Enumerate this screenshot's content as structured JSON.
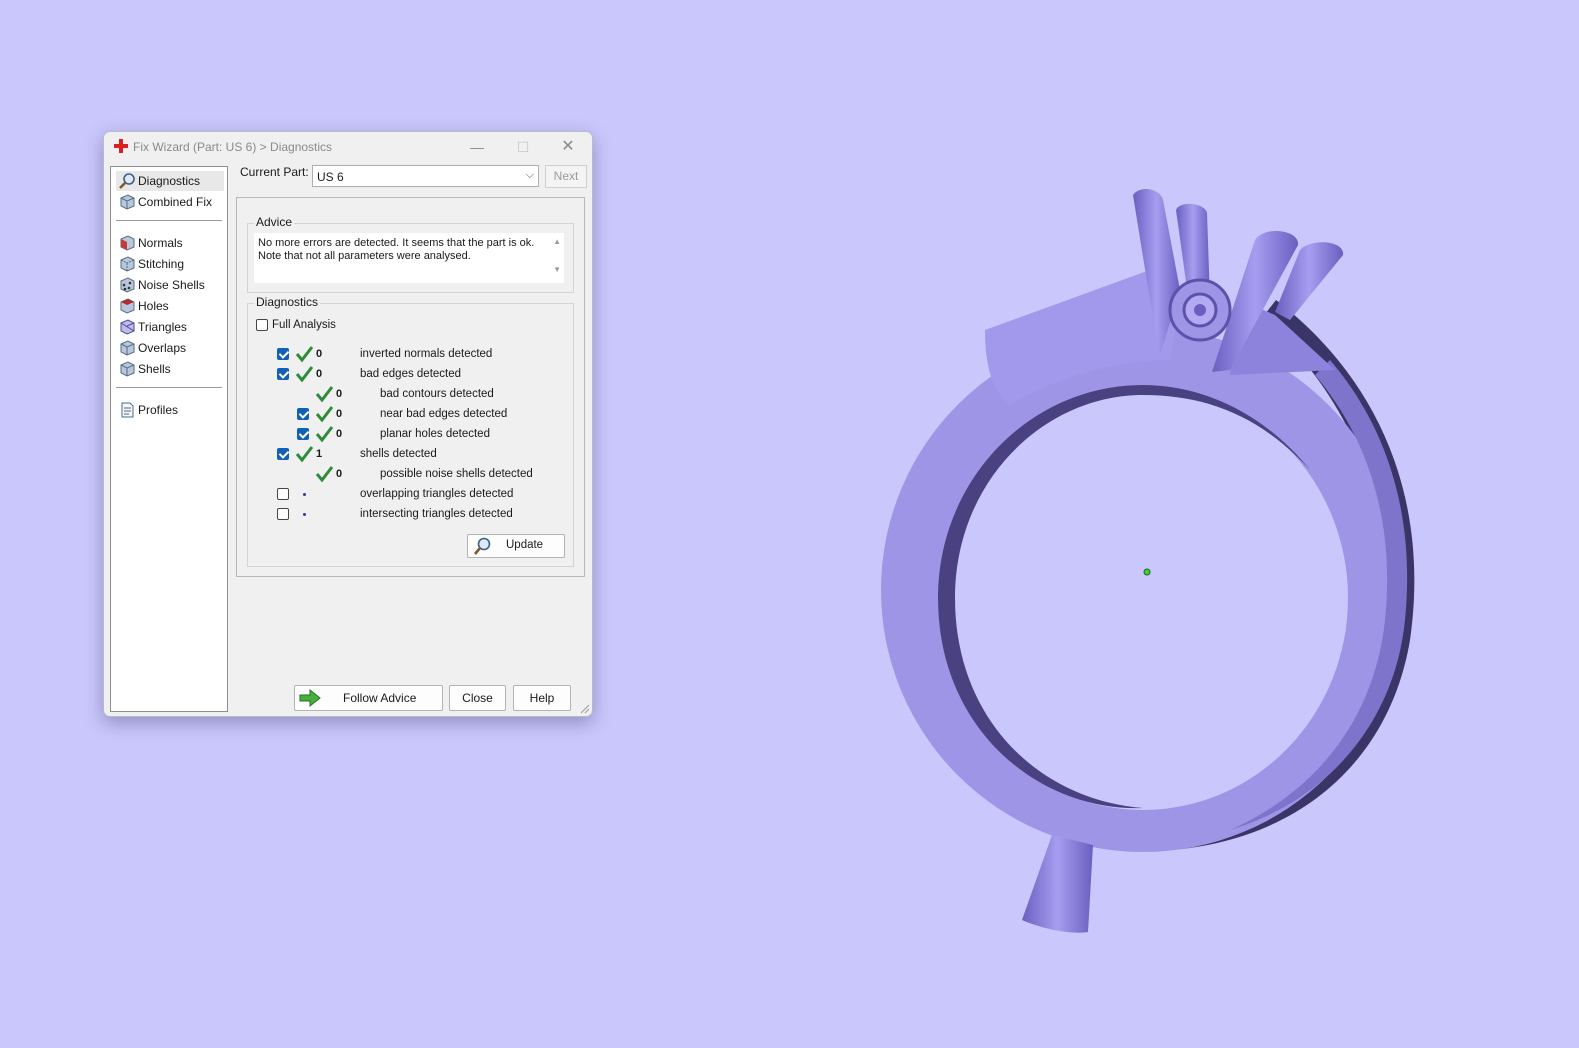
{
  "window": {
    "title": "Fix Wizard (Part: US 6) > Diagnostics",
    "minimize_icon": "minimize-icon",
    "maximize_icon": "maximize-icon",
    "close_icon": "close-icon"
  },
  "nav": {
    "items": [
      {
        "label": "Diagnostics",
        "icon": "magnifier-icon",
        "selected": true
      },
      {
        "label": "Combined Fix",
        "icon": "cube-icon"
      },
      {
        "label": "Normals",
        "icon": "normals-cube-icon"
      },
      {
        "label": "Stitching",
        "icon": "stitching-cube-icon"
      },
      {
        "label": "Noise Shells",
        "icon": "noise-shells-icon"
      },
      {
        "label": "Holes",
        "icon": "holes-cube-icon"
      },
      {
        "label": "Triangles",
        "icon": "triangles-cube-icon"
      },
      {
        "label": "Overlaps",
        "icon": "overlaps-cube-icon"
      },
      {
        "label": "Shells",
        "icon": "shells-cube-icon"
      },
      {
        "label": "Profiles",
        "icon": "document-icon"
      }
    ]
  },
  "current_part": {
    "label": "Current Part:",
    "value": "US 6",
    "next_label": "Next"
  },
  "advice": {
    "title": "Advice",
    "text": "No more errors are detected. It seems that the part is ok. Note that not all parameters were analysed."
  },
  "diagnostics": {
    "title": "Diagnostics",
    "full_analysis_label": "Full Analysis",
    "full_analysis_checked": false,
    "rows": [
      {
        "checked": true,
        "status": "ok",
        "count": "0",
        "label": "inverted normals detected",
        "indent": 0
      },
      {
        "checked": true,
        "status": "ok",
        "count": "0",
        "label": "bad edges detected",
        "indent": 0
      },
      {
        "checkbox": false,
        "status": "ok",
        "count": "0",
        "label": "bad contours detected",
        "indent": 1
      },
      {
        "checked": true,
        "status": "ok",
        "count": "0",
        "label": "near bad edges detected",
        "indent": 1
      },
      {
        "checked": true,
        "status": "ok",
        "count": "0",
        "label": "planar holes detected",
        "indent": 1
      },
      {
        "checked": true,
        "status": "ok",
        "count": "1",
        "label": "shells detected",
        "indent": 0
      },
      {
        "checkbox": false,
        "status": "ok",
        "count": "0",
        "label": "possible noise shells detected",
        "indent": 1
      },
      {
        "checked": false,
        "status": "not-analysed",
        "count": "",
        "label": "overlapping triangles detected",
        "indent": 0
      },
      {
        "checked": false,
        "status": "not-analysed",
        "count": "",
        "label": "intersecting triangles detected",
        "indent": 0
      }
    ],
    "update_label": "Update"
  },
  "buttons": {
    "follow_advice": "Follow Advice",
    "close": "Close",
    "help": "Help"
  },
  "colors": {
    "background": "#c9c7fb",
    "model": "#9f95e6",
    "checkbox_on": "#1160b8",
    "tick": "#2e8b3a"
  }
}
